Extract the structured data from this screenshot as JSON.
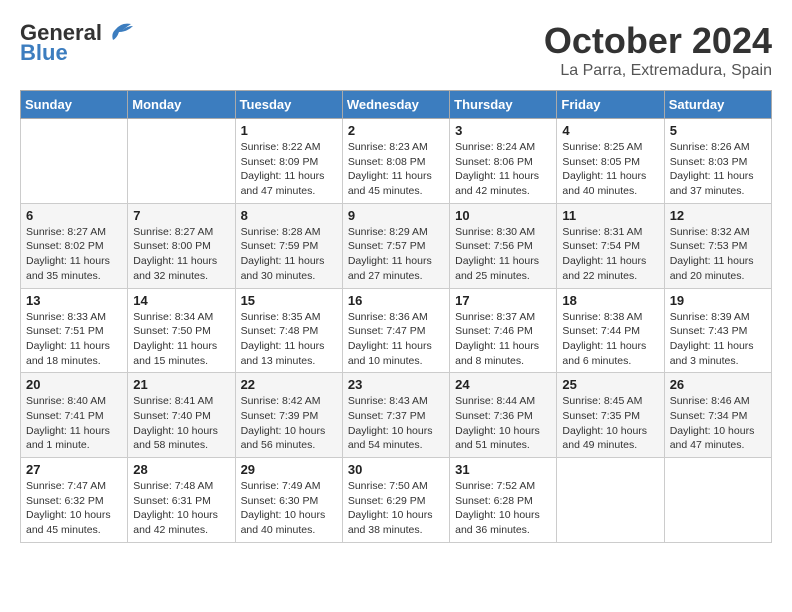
{
  "header": {
    "logo_general": "General",
    "logo_blue": "Blue",
    "month": "October 2024",
    "location": "La Parra, Extremadura, Spain"
  },
  "days_of_week": [
    "Sunday",
    "Monday",
    "Tuesday",
    "Wednesday",
    "Thursday",
    "Friday",
    "Saturday"
  ],
  "weeks": [
    [
      {
        "day": "",
        "sunrise": "",
        "sunset": "",
        "daylight": ""
      },
      {
        "day": "",
        "sunrise": "",
        "sunset": "",
        "daylight": ""
      },
      {
        "day": "1",
        "sunrise": "Sunrise: 8:22 AM",
        "sunset": "Sunset: 8:09 PM",
        "daylight": "Daylight: 11 hours and 47 minutes."
      },
      {
        "day": "2",
        "sunrise": "Sunrise: 8:23 AM",
        "sunset": "Sunset: 8:08 PM",
        "daylight": "Daylight: 11 hours and 45 minutes."
      },
      {
        "day": "3",
        "sunrise": "Sunrise: 8:24 AM",
        "sunset": "Sunset: 8:06 PM",
        "daylight": "Daylight: 11 hours and 42 minutes."
      },
      {
        "day": "4",
        "sunrise": "Sunrise: 8:25 AM",
        "sunset": "Sunset: 8:05 PM",
        "daylight": "Daylight: 11 hours and 40 minutes."
      },
      {
        "day": "5",
        "sunrise": "Sunrise: 8:26 AM",
        "sunset": "Sunset: 8:03 PM",
        "daylight": "Daylight: 11 hours and 37 minutes."
      }
    ],
    [
      {
        "day": "6",
        "sunrise": "Sunrise: 8:27 AM",
        "sunset": "Sunset: 8:02 PM",
        "daylight": "Daylight: 11 hours and 35 minutes."
      },
      {
        "day": "7",
        "sunrise": "Sunrise: 8:27 AM",
        "sunset": "Sunset: 8:00 PM",
        "daylight": "Daylight: 11 hours and 32 minutes."
      },
      {
        "day": "8",
        "sunrise": "Sunrise: 8:28 AM",
        "sunset": "Sunset: 7:59 PM",
        "daylight": "Daylight: 11 hours and 30 minutes."
      },
      {
        "day": "9",
        "sunrise": "Sunrise: 8:29 AM",
        "sunset": "Sunset: 7:57 PM",
        "daylight": "Daylight: 11 hours and 27 minutes."
      },
      {
        "day": "10",
        "sunrise": "Sunrise: 8:30 AM",
        "sunset": "Sunset: 7:56 PM",
        "daylight": "Daylight: 11 hours and 25 minutes."
      },
      {
        "day": "11",
        "sunrise": "Sunrise: 8:31 AM",
        "sunset": "Sunset: 7:54 PM",
        "daylight": "Daylight: 11 hours and 22 minutes."
      },
      {
        "day": "12",
        "sunrise": "Sunrise: 8:32 AM",
        "sunset": "Sunset: 7:53 PM",
        "daylight": "Daylight: 11 hours and 20 minutes."
      }
    ],
    [
      {
        "day": "13",
        "sunrise": "Sunrise: 8:33 AM",
        "sunset": "Sunset: 7:51 PM",
        "daylight": "Daylight: 11 hours and 18 minutes."
      },
      {
        "day": "14",
        "sunrise": "Sunrise: 8:34 AM",
        "sunset": "Sunset: 7:50 PM",
        "daylight": "Daylight: 11 hours and 15 minutes."
      },
      {
        "day": "15",
        "sunrise": "Sunrise: 8:35 AM",
        "sunset": "Sunset: 7:48 PM",
        "daylight": "Daylight: 11 hours and 13 minutes."
      },
      {
        "day": "16",
        "sunrise": "Sunrise: 8:36 AM",
        "sunset": "Sunset: 7:47 PM",
        "daylight": "Daylight: 11 hours and 10 minutes."
      },
      {
        "day": "17",
        "sunrise": "Sunrise: 8:37 AM",
        "sunset": "Sunset: 7:46 PM",
        "daylight": "Daylight: 11 hours and 8 minutes."
      },
      {
        "day": "18",
        "sunrise": "Sunrise: 8:38 AM",
        "sunset": "Sunset: 7:44 PM",
        "daylight": "Daylight: 11 hours and 6 minutes."
      },
      {
        "day": "19",
        "sunrise": "Sunrise: 8:39 AM",
        "sunset": "Sunset: 7:43 PM",
        "daylight": "Daylight: 11 hours and 3 minutes."
      }
    ],
    [
      {
        "day": "20",
        "sunrise": "Sunrise: 8:40 AM",
        "sunset": "Sunset: 7:41 PM",
        "daylight": "Daylight: 11 hours and 1 minute."
      },
      {
        "day": "21",
        "sunrise": "Sunrise: 8:41 AM",
        "sunset": "Sunset: 7:40 PM",
        "daylight": "Daylight: 10 hours and 58 minutes."
      },
      {
        "day": "22",
        "sunrise": "Sunrise: 8:42 AM",
        "sunset": "Sunset: 7:39 PM",
        "daylight": "Daylight: 10 hours and 56 minutes."
      },
      {
        "day": "23",
        "sunrise": "Sunrise: 8:43 AM",
        "sunset": "Sunset: 7:37 PM",
        "daylight": "Daylight: 10 hours and 54 minutes."
      },
      {
        "day": "24",
        "sunrise": "Sunrise: 8:44 AM",
        "sunset": "Sunset: 7:36 PM",
        "daylight": "Daylight: 10 hours and 51 minutes."
      },
      {
        "day": "25",
        "sunrise": "Sunrise: 8:45 AM",
        "sunset": "Sunset: 7:35 PM",
        "daylight": "Daylight: 10 hours and 49 minutes."
      },
      {
        "day": "26",
        "sunrise": "Sunrise: 8:46 AM",
        "sunset": "Sunset: 7:34 PM",
        "daylight": "Daylight: 10 hours and 47 minutes."
      }
    ],
    [
      {
        "day": "27",
        "sunrise": "Sunrise: 7:47 AM",
        "sunset": "Sunset: 6:32 PM",
        "daylight": "Daylight: 10 hours and 45 minutes."
      },
      {
        "day": "28",
        "sunrise": "Sunrise: 7:48 AM",
        "sunset": "Sunset: 6:31 PM",
        "daylight": "Daylight: 10 hours and 42 minutes."
      },
      {
        "day": "29",
        "sunrise": "Sunrise: 7:49 AM",
        "sunset": "Sunset: 6:30 PM",
        "daylight": "Daylight: 10 hours and 40 minutes."
      },
      {
        "day": "30",
        "sunrise": "Sunrise: 7:50 AM",
        "sunset": "Sunset: 6:29 PM",
        "daylight": "Daylight: 10 hours and 38 minutes."
      },
      {
        "day": "31",
        "sunrise": "Sunrise: 7:52 AM",
        "sunset": "Sunset: 6:28 PM",
        "daylight": "Daylight: 10 hours and 36 minutes."
      },
      {
        "day": "",
        "sunrise": "",
        "sunset": "",
        "daylight": ""
      },
      {
        "day": "",
        "sunrise": "",
        "sunset": "",
        "daylight": ""
      }
    ]
  ]
}
